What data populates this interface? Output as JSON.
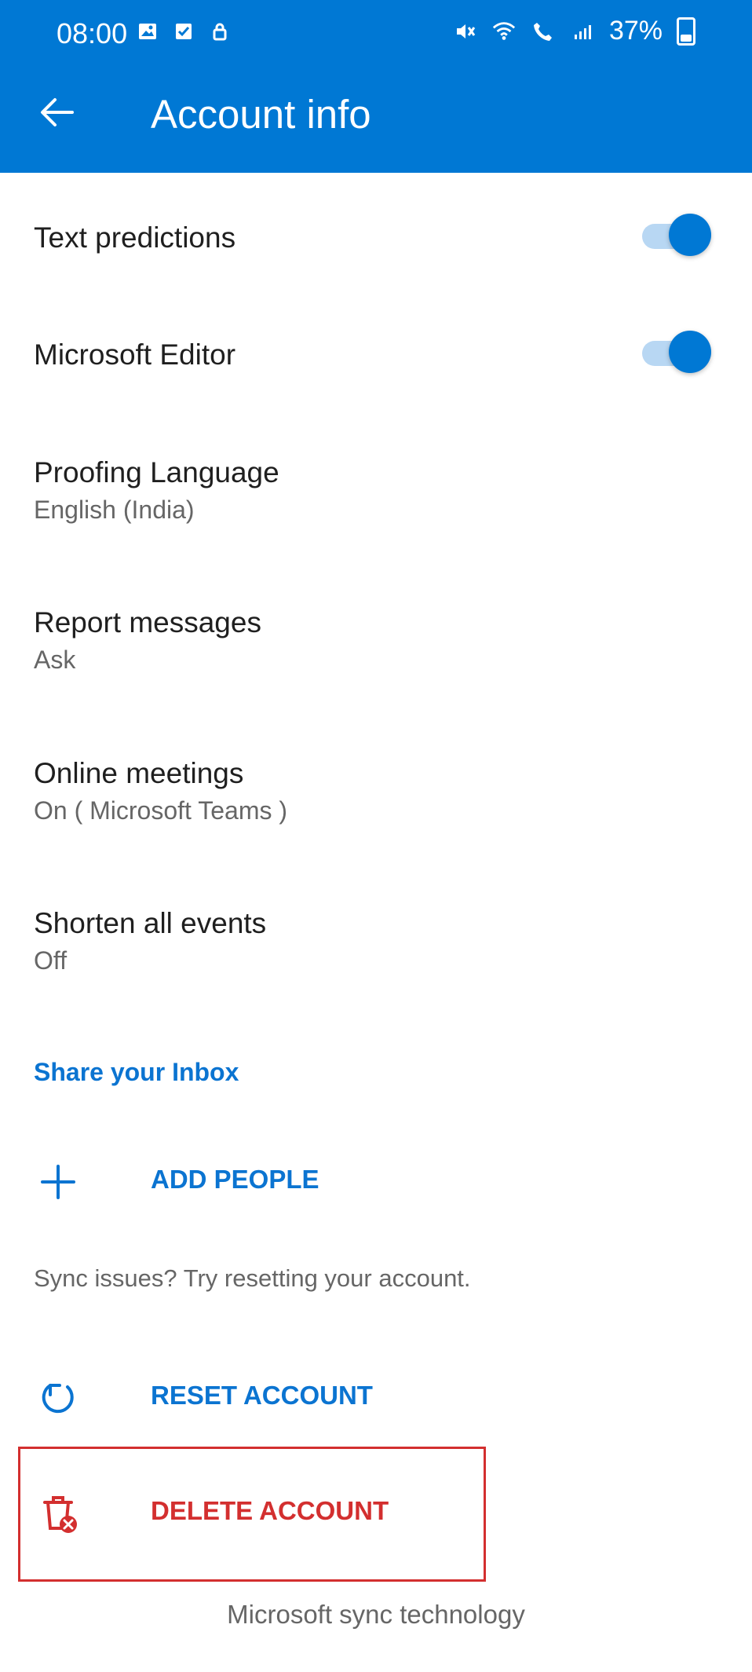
{
  "status": {
    "time": "08:00",
    "battery": "37%"
  },
  "header": {
    "title": "Account info"
  },
  "settings": [
    {
      "title": "Text predictions",
      "toggle": true
    },
    {
      "title": "Microsoft Editor",
      "toggle": true
    },
    {
      "title": "Proofing Language",
      "subtitle": "English (India)"
    },
    {
      "title": "Report messages",
      "subtitle": "Ask"
    },
    {
      "title": "Online meetings",
      "subtitle": "On ( Microsoft Teams )"
    },
    {
      "title": "Shorten all events",
      "subtitle": "Off"
    }
  ],
  "share": {
    "title": "Share your Inbox",
    "add_people": "ADD PEOPLE"
  },
  "sync": {
    "note": "Sync issues? Try resetting your account.",
    "reset": "RESET ACCOUNT",
    "delete": "DELETE ACCOUNT"
  },
  "footer": {
    "text": "Microsoft sync technology"
  },
  "colors": {
    "accent": "#0078d4",
    "danger": "#d32f2f"
  },
  "icons": {
    "back": "arrow-left-icon",
    "add": "plus-icon",
    "reset": "refresh-icon",
    "delete": "trash-error-icon"
  }
}
